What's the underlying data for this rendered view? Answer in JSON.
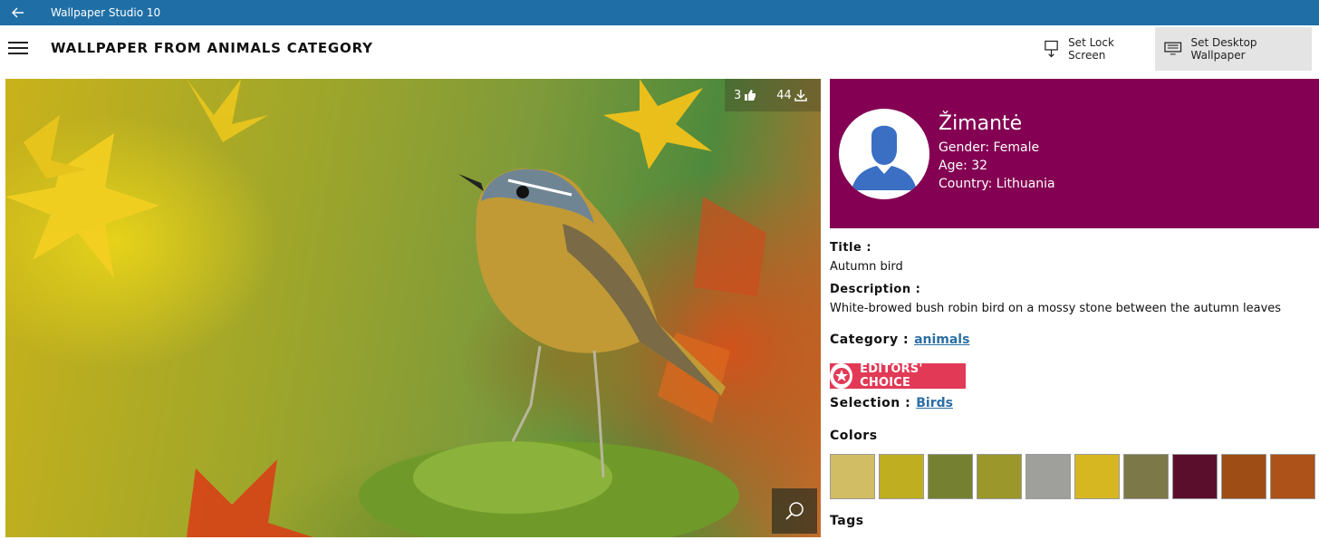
{
  "titlebar": {
    "app_title": "Wallpaper Studio 10"
  },
  "header": {
    "page_title": "WALLPAPER FROM ANIMALS CATEGORY",
    "set_lock_screen_label": "Set Lock Screen",
    "set_desktop_label": "Set Desktop Wallpaper"
  },
  "image": {
    "likes": "3",
    "downloads": "44"
  },
  "profile": {
    "name": "Žimantė",
    "gender": "Gender: Female",
    "age": "Age: 32",
    "country": "Country: Lithuania"
  },
  "details": {
    "title_label": "Title :",
    "title_value": "Autumn bird",
    "description_label": "Description :",
    "description_value": "White-browed bush robin bird on a mossy stone between the autumn leaves",
    "category_label": "Category :",
    "category_value": "animals",
    "badge_text": "EDITORS' CHOICE",
    "selection_label": "Selection :",
    "selection_value": "Birds",
    "colors_label": "Colors",
    "tags_label": "Tags",
    "colors": [
      "#d1bd63",
      "#c0ae21",
      "#758130",
      "#9b972b",
      "#9fa09b",
      "#d6b721",
      "#7c7847",
      "#5b0e2b",
      "#9e4e14",
      "#ad5218"
    ]
  }
}
